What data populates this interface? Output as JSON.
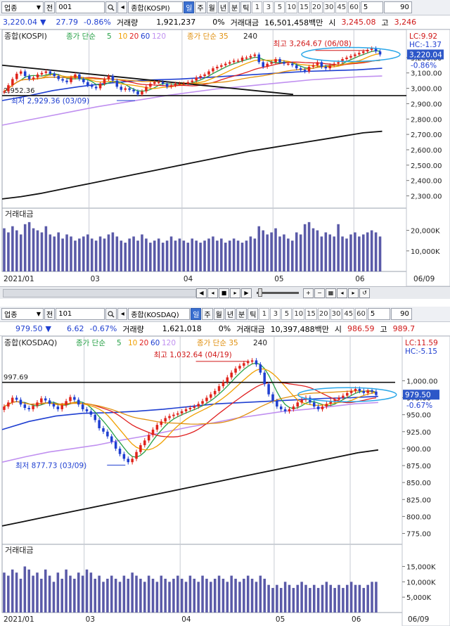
{
  "panels": [
    {
      "id": "kospi",
      "toolbar": {
        "sector_label": "업종",
        "sector_dropdown": "▼",
        "period_label": "전",
        "code": "001",
        "name": "종합(KOSPI)",
        "periods": [
          "일",
          "주",
          "월",
          "년",
          "분",
          "틱"
        ],
        "active_period": "일",
        "numbers": [
          "1",
          "3",
          "5",
          "10",
          "15",
          "20",
          "30",
          "45",
          "60"
        ],
        "count_value": "5",
        "zoom_value": "90"
      },
      "quote": {
        "price": "3,220.04",
        "direction": "▼",
        "change": "27.79",
        "change_pct": "-0.86%",
        "volume_label": "거래량",
        "volume": "1,921,237",
        "volume_pct": "0%",
        "amount_label": "거래대금",
        "amount": "16,501,458백만",
        "open_label": "시",
        "open": "3,245.08",
        "high_label": "고",
        "high": "3,246"
      },
      "chart_title": "종합(KOSPI)",
      "ma_label_prefix": "종가 단순",
      "ma_periods": [
        "5",
        "10",
        "20",
        "60",
        "120"
      ],
      "ma2_label": "종가 단순 35",
      "ma2_extra": "240",
      "lc_text": "LC:9.92",
      "hc_text": "HC:-1.37",
      "current_price_box": "3,220.04",
      "pct_text": "-0.86%",
      "max_annot": "최고 3,264.67 (06/08)",
      "min_annot": "최저 2,929.36 (03/09)",
      "hline_label": "2,952.36",
      "volume_title": "거래대금",
      "x_labels": [
        "2021/01",
        "03",
        "04",
        "05",
        "06",
        "06/09"
      ],
      "price_ticks": [
        "3,200.00",
        "3,100.00",
        "3,000.00",
        "2,900.00",
        "2,800.00",
        "2,700.00",
        "2,600.00",
        "2,500.00",
        "2,400.00",
        "2,300.00"
      ],
      "vol_ticks": [
        "20,000K",
        "10,000K"
      ]
    },
    {
      "id": "kosdaq",
      "toolbar": {
        "sector_label": "업종",
        "sector_dropdown": "▼",
        "period_label": "전",
        "code": "101",
        "name": "종합(KOSDAQ)",
        "periods": [
          "일",
          "주",
          "월",
          "년",
          "분",
          "틱"
        ],
        "active_period": "일",
        "numbers": [
          "1",
          "3",
          "5",
          "10",
          "15",
          "20",
          "30",
          "45",
          "60"
        ],
        "count_value": "5",
        "zoom_value": "90"
      },
      "quote": {
        "price": "979.50",
        "direction": "▼",
        "change": "6.62",
        "change_pct": "-0.67%",
        "volume_label": "거래량",
        "volume": "1,621,018",
        "volume_pct": "0%",
        "amount_label": "거래대금",
        "amount": "10,397,488백만",
        "open_label": "시",
        "open": "986.59",
        "high_label": "고",
        "high": "989.7"
      },
      "chart_title": "종합(KOSDAQ)",
      "ma_label_prefix": "종가 단순",
      "ma_periods": [
        "5",
        "10",
        "20",
        "60",
        "120"
      ],
      "ma2_label": "종가 단순 35",
      "ma2_extra": "240",
      "lc_text": "LC:11.59",
      "hc_text": "HC:-5.15",
      "current_price_box": "979.50",
      "pct_text": "-0.67%",
      "max_annot": "최고 1,032.64 (04/19)",
      "min_annot": "최저 877.73 (03/09)",
      "hline_label": "997.69",
      "volume_title": "거래대금",
      "x_labels": [
        "2021/01",
        "03",
        "04",
        "05",
        "06",
        "06/09"
      ],
      "price_ticks": [
        "1,000.00",
        "975.00",
        "950.00",
        "925.00",
        "900.00",
        "875.00",
        "850.00",
        "825.00",
        "800.00",
        "775.00"
      ],
      "vol_ticks": [
        "15,000K",
        "10,000K",
        "5,000K"
      ]
    }
  ],
  "colors": {
    "up": "#e0241b",
    "down": "#1f3fd1",
    "ma5": "#26a046",
    "ma10": "#f0a000",
    "ma20": "#e02020",
    "ma60": "#1f3fd1",
    "ma120": "#c090f0",
    "ma35": "#e09010",
    "ma240": "#111111",
    "volume": "#5a5aa8",
    "tag_red": "#d01818",
    "tag_blue": "#1f3fd1"
  },
  "chart_data": [
    {
      "type": "candlestick",
      "title": "종합(KOSPI)",
      "ylim": [
        2220,
        3300
      ],
      "x_range": [
        "2021/01",
        "06/09"
      ],
      "close_series": [
        2980,
        3020,
        3060,
        3095,
        3110,
        3080,
        3060,
        3070,
        3090,
        3100,
        3110,
        3095,
        3080,
        3060,
        3050,
        3040,
        3070,
        3090,
        3060,
        3040,
        3020,
        3010,
        3000,
        3030,
        3060,
        3080,
        3050,
        3010,
        2990,
        3000,
        2990,
        2980,
        2960,
        2980,
        3010,
        3030,
        3040,
        3040,
        3030,
        3010,
        3020,
        3030,
        3030,
        3030,
        3040,
        3050,
        3070,
        3080,
        3090,
        3110,
        3130,
        3140,
        3150,
        3160,
        3170,
        3180,
        3180,
        3200,
        3200,
        3210,
        3220,
        3170,
        3140,
        3160,
        3170,
        3190,
        3170,
        3160,
        3160,
        3150,
        3130,
        3120,
        3110,
        3140,
        3150,
        3170,
        3140,
        3130,
        3150,
        3160,
        3170,
        3190,
        3200,
        3210,
        3220,
        3230,
        3240,
        3250,
        3260,
        3240,
        3220
      ],
      "ma240": [
        2280,
        2295,
        2315,
        2340,
        2365,
        2390,
        2415,
        2440,
        2465,
        2490,
        2515,
        2540,
        2565,
        2590,
        2610,
        2630,
        2650,
        2670,
        2690,
        2710,
        2720
      ],
      "ma120": [
        2760,
        2790,
        2820,
        2850,
        2880,
        2905,
        2930,
        2955,
        2975,
        2995,
        3010,
        3025,
        3040,
        3055,
        3065,
        3075,
        3080
      ],
      "ma60": [
        2920,
        2950,
        2985,
        3010,
        3030,
        3045,
        3055,
        3060,
        3070,
        3080,
        3090,
        3100,
        3110,
        3115,
        3120,
        3130
      ],
      "trendlines": [
        {
          "from": [
            0,
            3150
          ],
          "to": [
            0.72,
            2960
          ]
        }
      ],
      "hline": 2952.36,
      "max": {
        "value": 3264.67,
        "date": "06/08"
      },
      "min": {
        "value": 2929.36,
        "date": "03/09"
      },
      "current": 3220.04,
      "y_ticks": [
        3200,
        3100,
        3000,
        2900,
        2800,
        2700,
        2600,
        2500,
        2400,
        2300
      ],
      "volume": [
        21,
        19,
        22,
        20,
        18,
        23,
        24,
        21,
        20,
        19,
        22,
        18,
        17,
        19,
        16,
        18,
        17,
        15,
        16,
        17,
        18,
        16,
        15,
        17,
        16,
        18,
        19,
        17,
        15,
        14,
        16,
        17,
        15,
        18,
        16,
        14,
        15,
        16,
        14,
        15,
        17,
        15,
        16,
        15,
        14,
        16,
        15,
        14,
        15,
        16,
        17,
        15,
        16,
        14,
        15,
        16,
        15,
        14,
        15,
        17,
        16,
        22,
        20,
        18,
        19,
        21,
        17,
        18,
        16,
        15,
        19,
        18,
        23,
        24,
        21,
        20,
        17,
        19,
        18,
        17,
        23,
        17,
        16,
        18,
        19,
        17,
        18,
        19,
        20,
        19,
        17
      ],
      "vol_ylim": [
        0,
        26000
      ],
      "vol_ticks": [
        20000,
        10000
      ]
    },
    {
      "type": "candlestick",
      "title": "종합(KOSDAQ)",
      "ylim": [
        760,
        1045
      ],
      "x_range": [
        "2021/01",
        "06/09"
      ],
      "close_series": [
        962,
        968,
        975,
        972,
        965,
        960,
        958,
        963,
        968,
        974,
        971,
        966,
        962,
        958,
        964,
        970,
        976,
        972,
        965,
        958,
        955,
        950,
        942,
        930,
        925,
        918,
        910,
        900,
        892,
        885,
        880,
        885,
        895,
        905,
        912,
        920,
        928,
        935,
        940,
        945,
        948,
        950,
        952,
        955,
        958,
        960,
        962,
        966,
        970,
        975,
        980,
        985,
        992,
        998,
        1005,
        1012,
        1018,
        1022,
        1026,
        1028,
        1030,
        1024,
        1012,
        995,
        980,
        970,
        962,
        958,
        955,
        958,
        962,
        968,
        972,
        975,
        968,
        962,
        958,
        962,
        966,
        970,
        972,
        975,
        978,
        982,
        985,
        988,
        985,
        982,
        986,
        984,
        979
      ],
      "ma240": [
        786,
        792,
        798,
        804,
        810,
        816,
        822,
        828,
        834,
        840,
        846,
        852,
        858,
        864,
        870,
        876,
        882,
        888,
        894,
        898
      ],
      "ma120": [
        880,
        888,
        895,
        900,
        905,
        912,
        918,
        925,
        932,
        938,
        945,
        950,
        955,
        958,
        962,
        966,
        968
      ],
      "ma60": [
        928,
        940,
        948,
        952,
        953,
        955,
        958,
        962,
        966,
        968,
        970,
        972,
        974,
        975,
        977
      ],
      "hline": 997.69,
      "max": {
        "value": 1032.64,
        "date": "04/19"
      },
      "min": {
        "value": 877.73,
        "date": "03/09"
      },
      "current": 979.5,
      "y_ticks": [
        1000,
        975,
        950,
        925,
        900,
        875,
        850,
        825,
        800,
        775
      ],
      "volume": [
        13,
        12,
        14,
        13,
        11,
        15,
        14,
        12,
        13,
        11,
        14,
        12,
        10,
        13,
        11,
        14,
        12,
        11,
        13,
        12,
        14,
        13,
        11,
        12,
        10,
        11,
        12,
        11,
        10,
        12,
        11,
        13,
        12,
        11,
        10,
        12,
        11,
        10,
        12,
        11,
        10,
        11,
        12,
        11,
        10,
        12,
        11,
        10,
        12,
        11,
        10,
        11,
        12,
        11,
        10,
        12,
        11,
        10,
        11,
        12,
        11,
        10,
        12,
        11,
        9,
        8,
        9,
        8,
        10,
        9,
        8,
        9,
        10,
        9,
        8,
        9,
        8,
        9,
        10,
        9,
        8,
        9,
        8,
        9,
        10,
        9,
        9,
        8,
        9,
        10,
        10
      ],
      "vol_ylim": [
        0,
        19000
      ],
      "vol_ticks": [
        15000,
        10000,
        5000
      ]
    }
  ]
}
